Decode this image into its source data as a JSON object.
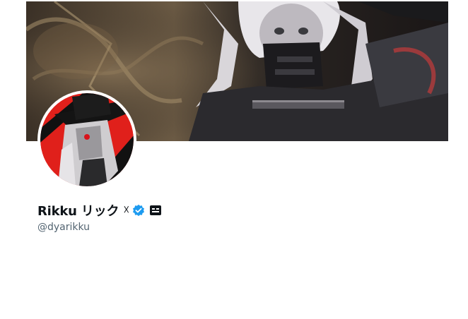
{
  "profile": {
    "display_name": "Rikku リック",
    "name_symbol": "☓",
    "handle": "@dyarikku",
    "verified": true
  },
  "icons": {
    "verified": "verified-badge-icon",
    "affiliate": "affiliate-badge-icon"
  },
  "colors": {
    "verified_blue": "#1d9bf0",
    "handle_gray": "#536471",
    "name_text": "#0f1419",
    "avatar_red": "#e0201b"
  }
}
